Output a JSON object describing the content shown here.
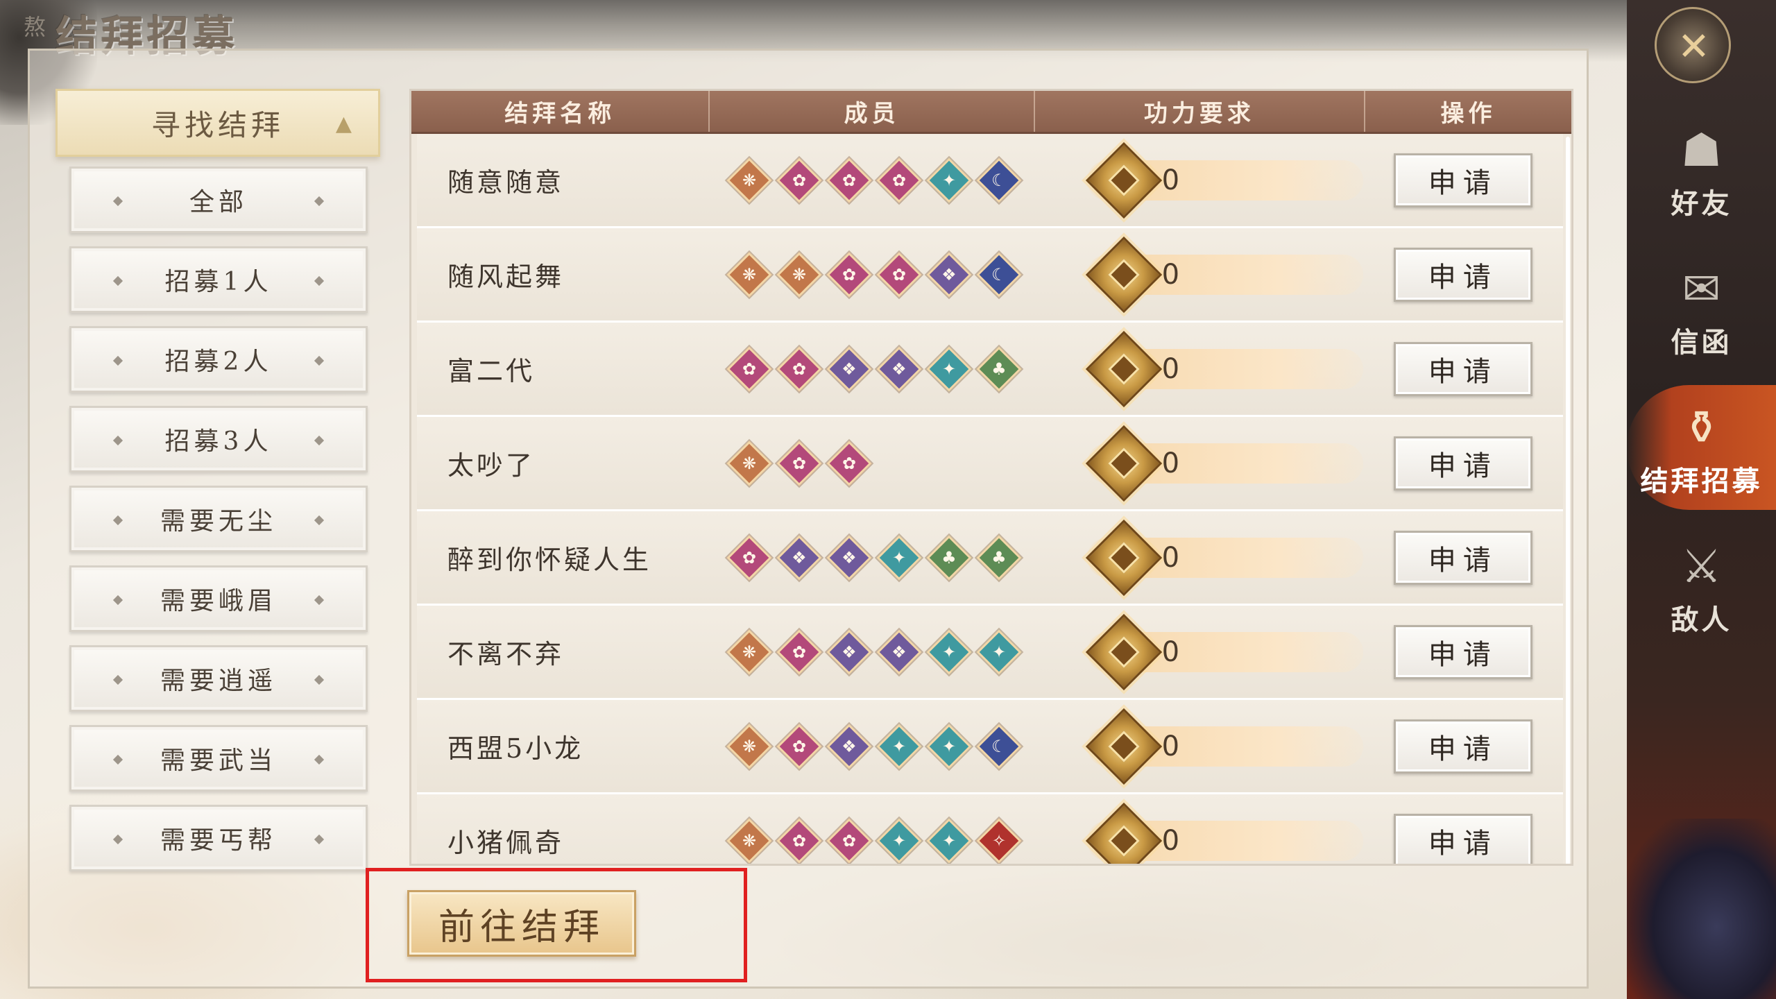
{
  "page": {
    "title": "结拜招募",
    "title_prefix": "熬"
  },
  "filter": {
    "header_label": "寻找结拜",
    "header_arrow": "▲",
    "items": [
      {
        "label": "全部"
      },
      {
        "label": "招募1人"
      },
      {
        "label": "招募2人"
      },
      {
        "label": "招募3人"
      },
      {
        "label": "需要无尘"
      },
      {
        "label": "需要峨眉"
      },
      {
        "label": "需要逍遥"
      },
      {
        "label": "需要武当"
      },
      {
        "label": "需要丐帮"
      }
    ]
  },
  "table": {
    "headers": [
      "结拜名称",
      "成员",
      "功力要求",
      "操作"
    ],
    "apply_label": "申请",
    "rows": [
      {
        "name": "随意随意",
        "members": [
          "orange-flame",
          "pink-lotus",
          "pink-lotus",
          "pink-lotus",
          "teal-crane",
          "blue-wave"
        ],
        "power": "0"
      },
      {
        "name": "随风起舞",
        "members": [
          "orange-flame",
          "orange-flame",
          "pink-lotus",
          "pink-lotus",
          "purple-fan",
          "blue-wave"
        ],
        "power": "0"
      },
      {
        "name": "富二代",
        "members": [
          "pink-lotus",
          "pink-lotus",
          "purple-fan",
          "purple-fan",
          "teal-crane",
          "green-gourd"
        ],
        "power": "0"
      },
      {
        "name": "太吵了",
        "members": [
          "orange-flame",
          "pink-lotus",
          "pink-lotus"
        ],
        "power": "0"
      },
      {
        "name": "醉到你怀疑人生",
        "members": [
          "pink-lotus",
          "purple-fan",
          "purple-fan",
          "teal-crane",
          "green-gourd",
          "green-gourd"
        ],
        "power": "0"
      },
      {
        "name": "不离不弃",
        "members": [
          "orange-flame",
          "pink-lotus",
          "purple-fan",
          "purple-fan",
          "teal-crane",
          "teal-crane"
        ],
        "power": "0"
      },
      {
        "name": "西盟5小龙",
        "members": [
          "orange-flame",
          "pink-lotus",
          "purple-fan",
          "teal-crane",
          "teal-crane",
          "blue-wave"
        ],
        "power": "0"
      },
      {
        "name": "小猪佩奇",
        "members": [
          "orange-flame",
          "pink-lotus",
          "pink-lotus",
          "teal-crane",
          "teal-crane",
          "red-blade"
        ],
        "power": "0"
      }
    ]
  },
  "goto_button": {
    "label": "前往结拜"
  },
  "nav": {
    "items": [
      {
        "label": "好友",
        "icon": "friends-icon"
      },
      {
        "label": "信函",
        "icon": "mail-icon"
      },
      {
        "label": "结拜招募",
        "icon": "sworn-recruit-icon",
        "active": true
      },
      {
        "label": "敌人",
        "icon": "enemy-icon"
      }
    ]
  },
  "colors": {
    "header_brown": "#8a604d",
    "active_nav": "#c95522",
    "highlight_red": "#e02020",
    "gem_orange": "#c2774a",
    "gem_pink": "#b3497a",
    "gem_purple": "#6f5a9c",
    "gem_teal": "#3f9aa0",
    "gem_green": "#5d8c55",
    "gem_blue": "#3d4f96",
    "gem_red": "#b0322d"
  }
}
